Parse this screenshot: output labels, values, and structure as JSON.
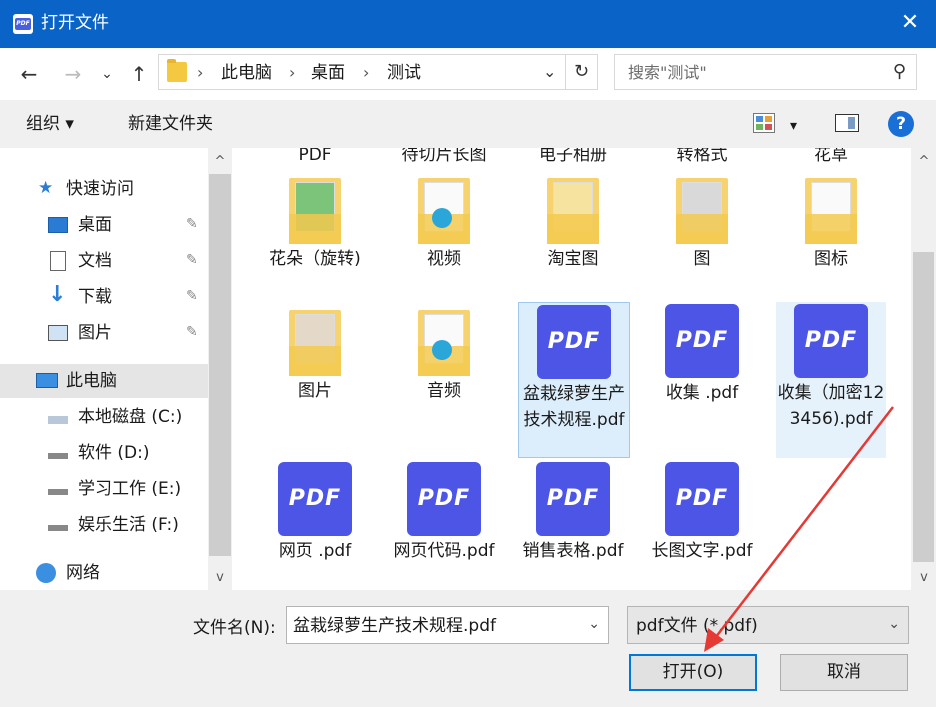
{
  "window": {
    "title": "打开文件",
    "close_glyph": "✕"
  },
  "nav": {
    "back": "←",
    "forward": "→",
    "recent": "⌄",
    "up": "↑",
    "breadcrumb": [
      "此电脑",
      "桌面",
      "测试"
    ],
    "separator": "›",
    "dropdown": "⌄",
    "refresh": "↻",
    "search_placeholder": "搜索\"测试\"",
    "search_icon": "⚲"
  },
  "toolbar": {
    "organize": "组织 ▾",
    "new_folder": "新建文件夹",
    "view_dropdown": "▾",
    "help": "?"
  },
  "sidebar": {
    "items": [
      {
        "label": "快速访问",
        "icon": "star-icon"
      },
      {
        "label": "桌面",
        "icon": "desktop-icon",
        "pinned": true
      },
      {
        "label": "文档",
        "icon": "document-icon",
        "pinned": true
      },
      {
        "label": "下载",
        "icon": "download-icon",
        "pinned": true
      },
      {
        "label": "图片",
        "icon": "picture-icon",
        "pinned": true
      },
      {
        "label": "此电脑",
        "icon": "computer-icon",
        "selected": true
      },
      {
        "label": "本地磁盘 (C:)",
        "icon": "drive-icon"
      },
      {
        "label": "软件 (D:)",
        "icon": "drive-icon"
      },
      {
        "label": "学习工作 (E:)",
        "icon": "drive-icon"
      },
      {
        "label": "娱乐生活 (F:)",
        "icon": "drive-icon"
      },
      {
        "label": "网络",
        "icon": "network-icon"
      }
    ],
    "pin_glyph": "📌",
    "scroll_up": "^",
    "scroll_down": "v"
  },
  "files": {
    "top_cut_labels": [
      "PDF",
      "待切片长图",
      "电子相册",
      "转格式",
      "花草"
    ],
    "items": [
      {
        "name": "花朵（旋转)",
        "kind": "folder"
      },
      {
        "name": "视频",
        "kind": "folder"
      },
      {
        "name": "淘宝图",
        "kind": "folder"
      },
      {
        "name": "图",
        "kind": "folder"
      },
      {
        "name": "图标",
        "kind": "folder"
      },
      {
        "name": "图片",
        "kind": "folder"
      },
      {
        "name": "音频",
        "kind": "folder"
      },
      {
        "name": "盆栽绿萝生产技术规程.pdf",
        "kind": "pdf",
        "selected": true
      },
      {
        "name": "收集 .pdf",
        "kind": "pdf"
      },
      {
        "name": "收集（加密123456).pdf",
        "kind": "pdf",
        "hover": true
      },
      {
        "name": "网页 .pdf",
        "kind": "pdf"
      },
      {
        "name": "网页代码.pdf",
        "kind": "pdf"
      },
      {
        "name": "销售表格.pdf",
        "kind": "pdf"
      },
      {
        "name": "长图文字.pdf",
        "kind": "pdf"
      }
    ],
    "pdf_badge": "PDF"
  },
  "bottom": {
    "filename_label": "文件名(N):",
    "filename_value": "盆栽绿萝生产技术规程.pdf",
    "filetype_value": "pdf文件 (*.pdf)",
    "dropdown": "⌄",
    "open_button": "打开(O)",
    "cancel_button": "取消"
  },
  "colors": {
    "titlebar": "#0a64c8",
    "pdf_icon": "#4c55e6",
    "annotation_arrow": "#e53935"
  }
}
